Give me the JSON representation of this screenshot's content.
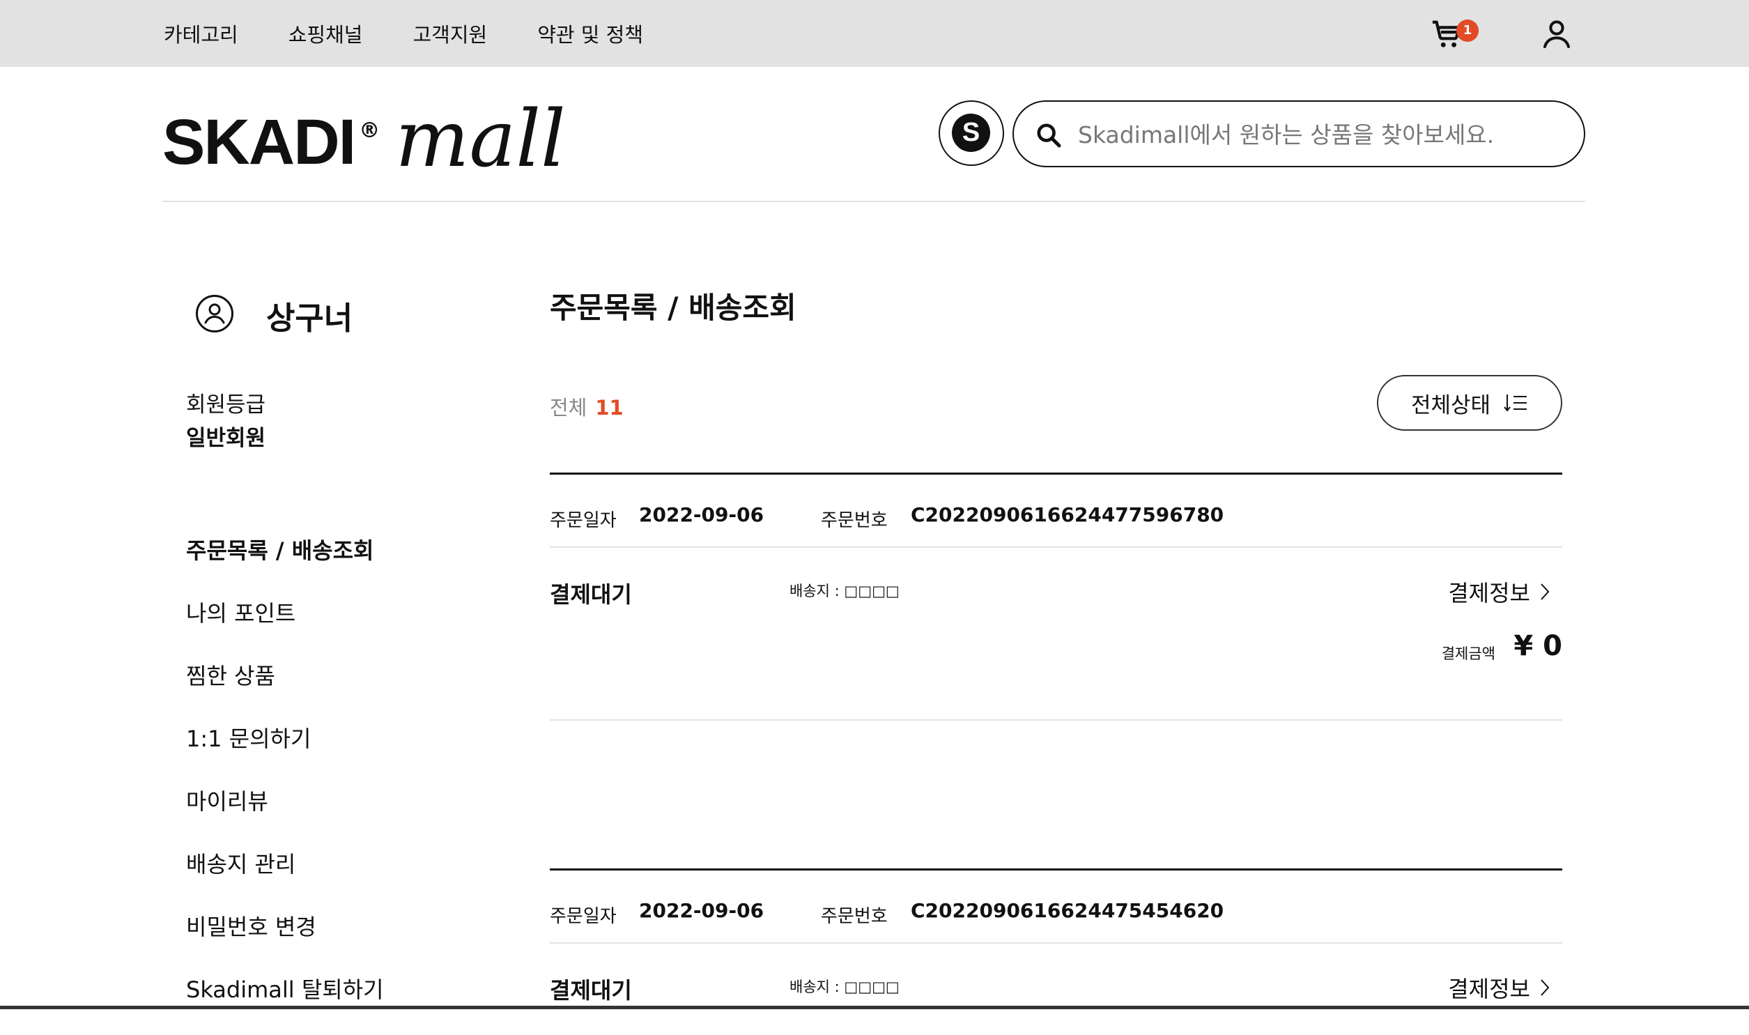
{
  "top_nav": [
    "카테고리",
    "쇼핑채널",
    "고객지원",
    "약관 및 정책"
  ],
  "cart": {
    "badge_count": "1"
  },
  "logo": {
    "brand": "SKADI",
    "reg_mark": "®",
    "script": "mall"
  },
  "search_button": {
    "label": "S"
  },
  "search": {
    "placeholder": "Skadimall에서 원하는 상품을 찾아보세요."
  },
  "profile": {
    "name": "상구너",
    "grade_label": "회원등급",
    "grade_value": "일반회원"
  },
  "sidebar": {
    "items": [
      {
        "label": "주문목록 / 배송조회",
        "active": true
      },
      {
        "label": "나의 포인트"
      },
      {
        "label": "찜한 상품"
      },
      {
        "label": "1:1 문의하기"
      },
      {
        "label": "마이리뷰"
      },
      {
        "label": "배송지 관리"
      },
      {
        "label": "비밀번호 변경"
      },
      {
        "label": "Skadimall 탈퇴하기"
      }
    ]
  },
  "main": {
    "title": "주문목록 / 배송조회",
    "total_label": "전체",
    "total_count": "11",
    "filter_label": "전체상태",
    "orders": [
      {
        "date_label": "주문일자",
        "date": "2022-09-06",
        "number_label": "주문번호",
        "number": "C2022090616624477596780",
        "status": "결제대기",
        "address": "배송지 : □□□□",
        "payinfo_label": "결제정보",
        "amount_label": "결제금액",
        "amount": "¥ 0"
      },
      {
        "date_label": "주문일자",
        "date": "2022-09-06",
        "number_label": "주문번호",
        "number": "C2022090616624475454620",
        "status": "결제대기",
        "address": "배송지 : □□□□",
        "payinfo_label": "결제정보"
      }
    ]
  },
  "colors": {
    "topbar_bg": "#e2e2e2",
    "accent": "#e24b26",
    "text": "#111111"
  }
}
